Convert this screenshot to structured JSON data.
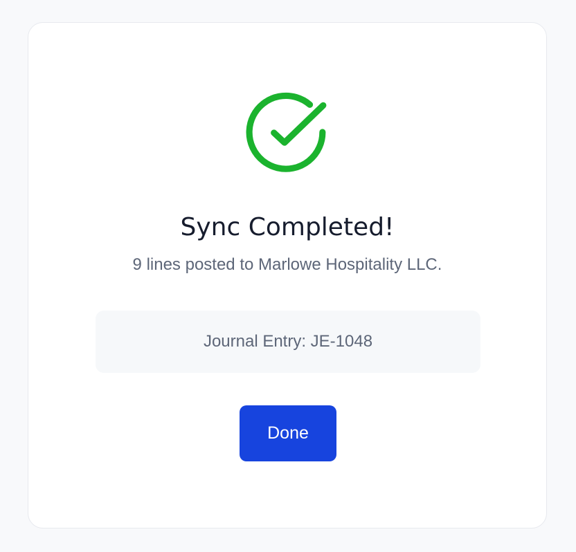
{
  "dialog": {
    "title": "Sync Completed!",
    "message": "9 lines posted to Marlowe Hospitality LLC.",
    "journal_entry": "Journal Entry: JE-1048",
    "done_label": "Done",
    "icon": "check-circle-icon"
  },
  "colors": {
    "success": "#1bb32e",
    "primary_button": "#1744de",
    "title_text": "#161c2d",
    "muted_text": "#5d6678"
  }
}
